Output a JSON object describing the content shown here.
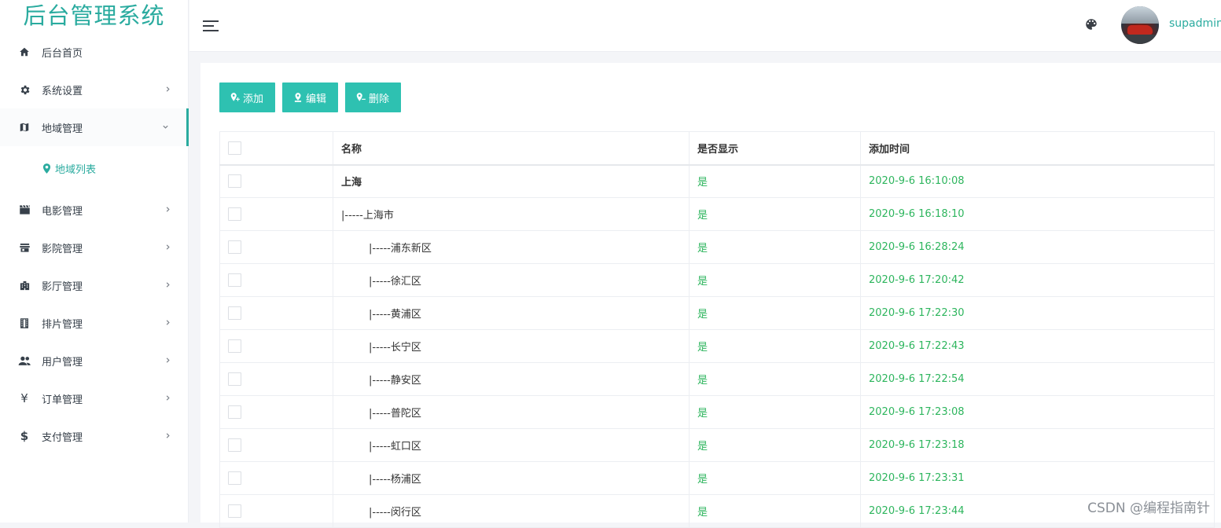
{
  "app": {
    "title": "后台管理系统"
  },
  "sidebar": {
    "items": [
      {
        "label": "后台首页",
        "icon": "home-icon",
        "has_arrow": false
      },
      {
        "label": "系统设置",
        "icon": "gear-icon",
        "has_arrow": true
      },
      {
        "label": "地域管理",
        "icon": "map-icon",
        "has_arrow": true,
        "expanded": true
      },
      {
        "label": "电影管理",
        "icon": "clapperboard-icon",
        "has_arrow": true
      },
      {
        "label": "影院管理",
        "icon": "store-icon",
        "has_arrow": true
      },
      {
        "label": "影厅管理",
        "icon": "building-icon",
        "has_arrow": true
      },
      {
        "label": "排片管理",
        "icon": "film-strip-icon",
        "has_arrow": true
      },
      {
        "label": "用户管理",
        "icon": "users-icon",
        "has_arrow": true
      },
      {
        "label": "订单管理",
        "icon": "yen-icon",
        "has_arrow": true
      },
      {
        "label": "支付管理",
        "icon": "dollar-icon",
        "has_arrow": true
      }
    ],
    "sub_items": [
      {
        "label": "地域列表",
        "icon": "map-pin-icon",
        "active": true
      }
    ]
  },
  "topbar": {
    "username": "supadmin"
  },
  "toolbar": {
    "add_label": "添加",
    "edit_label": "编辑",
    "delete_label": "删除"
  },
  "table": {
    "columns": [
      "名称",
      "是否显示",
      "添加时间"
    ],
    "rows": [
      {
        "name": "上海",
        "level": 0,
        "show": "是",
        "time": "2020-9-6 16:10:08"
      },
      {
        "name": "|-----上海市",
        "level": 1,
        "show": "是",
        "time": "2020-9-6 16:18:10"
      },
      {
        "name": "|-----浦东新区",
        "level": 2,
        "show": "是",
        "time": "2020-9-6 16:28:24"
      },
      {
        "name": "|-----徐汇区",
        "level": 2,
        "show": "是",
        "time": "2020-9-6 17:20:42"
      },
      {
        "name": "|-----黄浦区",
        "level": 2,
        "show": "是",
        "time": "2020-9-6 17:22:30"
      },
      {
        "name": "|-----长宁区",
        "level": 2,
        "show": "是",
        "time": "2020-9-6 17:22:43"
      },
      {
        "name": "|-----静安区",
        "level": 2,
        "show": "是",
        "time": "2020-9-6 17:22:54"
      },
      {
        "name": "|-----普陀区",
        "level": 2,
        "show": "是",
        "time": "2020-9-6 17:23:08"
      },
      {
        "name": "|-----虹口区",
        "level": 2,
        "show": "是",
        "time": "2020-9-6 17:23:18"
      },
      {
        "name": "|-----杨浦区",
        "level": 2,
        "show": "是",
        "time": "2020-9-6 17:23:31"
      },
      {
        "name": "|-----闵行区",
        "level": 2,
        "show": "是",
        "time": "2020-9-6 17:23:44"
      }
    ]
  },
  "watermark": "CSDN @编程指南针",
  "colors": {
    "accent": "#2aab9f",
    "button": "#2ec1b1",
    "green_text": "#2db55d"
  }
}
